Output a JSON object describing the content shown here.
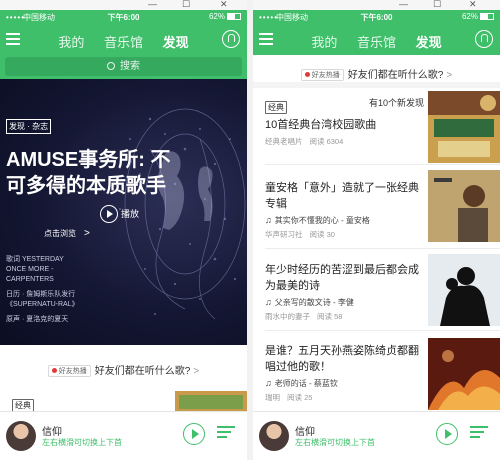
{
  "window": {
    "minimize": "—",
    "restore": "☐",
    "close": "✕"
  },
  "statusbar": {
    "signal": "•••••",
    "carrier": "中国移动",
    "time": "下午6:00",
    "battery": "62%"
  },
  "nav": {
    "tabs": [
      "我的",
      "音乐馆",
      "发现"
    ],
    "active_tab": "发现"
  },
  "search": {
    "placeholder": "搜索"
  },
  "hero": {
    "tag": "发现 · 杂志",
    "title": "AMUSE事务所: 不可多得的本质歌手",
    "play_label": "播放",
    "browse_label": "点击浏览",
    "credits": [
      "歌词 YESTERDAY",
      "ONCE MORE -",
      "CARPENTERS",
      "",
      "日历 · 詹姆斯乐队发行",
      "《SUPERNATU-RAL》",
      "",
      "原声 · 夏洛克的夏天"
    ]
  },
  "hot": {
    "badge": "好友热播",
    "text": "好友们都在听什么歌?",
    "chevron": ">"
  },
  "classic_tag": "经典",
  "feed": {
    "new_count": "有10个新发现",
    "items": [
      {
        "title": "10首经典台湾校园歌曲",
        "song": "",
        "author": "经典老唱片",
        "reads": "阅读 6304"
      },
      {
        "title": "童安格「意外」造就了一张经典专辑",
        "song": "其实你不懂我的心 - 童安格",
        "author": "华声研习社",
        "reads": "阅读 30"
      },
      {
        "title": "年少时经历的苦涩到最后都会成为最美的诗",
        "song": "父亲写的散文诗 - 李健",
        "author": "雨水中的妻子",
        "reads": "阅读 58"
      },
      {
        "title": "是谁？五月天孙燕姿陈绮贞都翻唱过他的歌！",
        "song": "老师的话 - 蔡蓝钦",
        "author": "瑞明",
        "reads": "阅读 25"
      }
    ]
  },
  "player": {
    "title": "信仰",
    "subtitle": "左右横滑可切换上下首"
  }
}
